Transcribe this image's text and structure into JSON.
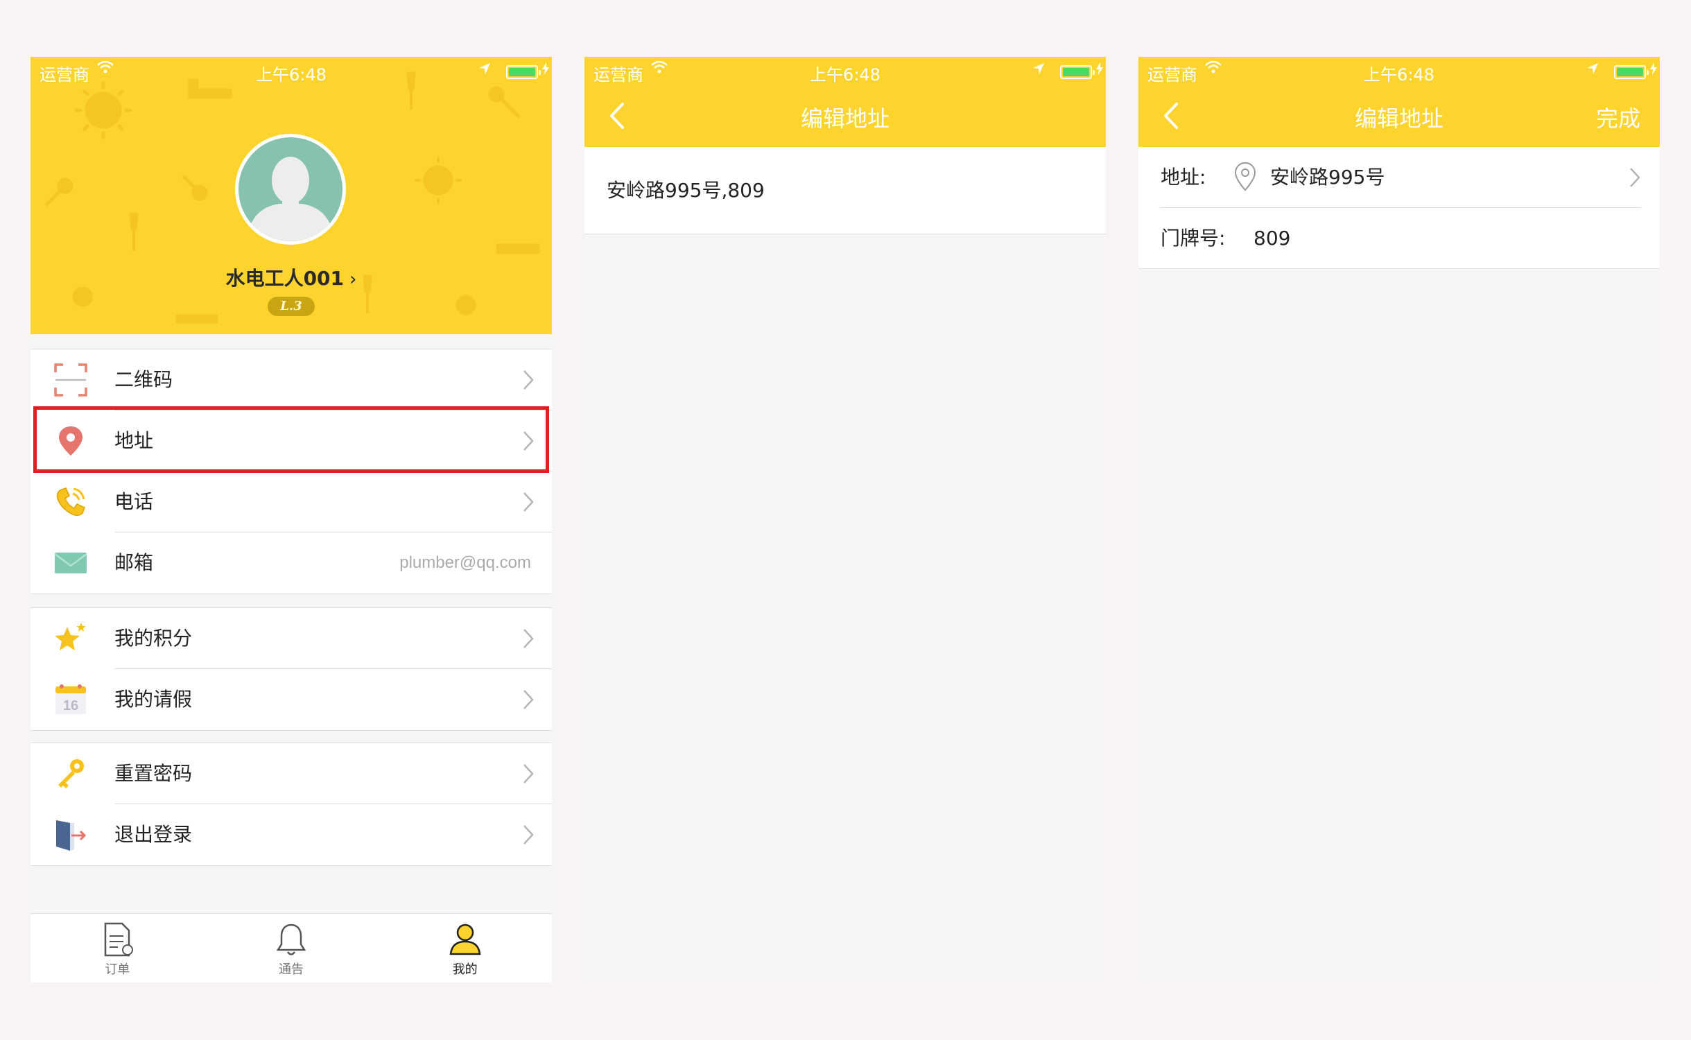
{
  "status_bar": {
    "carrier": "运营商",
    "time": "上午6:48"
  },
  "screen1": {
    "profile": {
      "username": "水电工人001",
      "level": "L.3"
    },
    "menu_group1": [
      {
        "label": "二维码",
        "icon": "qr-scan-icon",
        "value": ""
      },
      {
        "label": "地址",
        "icon": "location-pin-icon",
        "value": ""
      },
      {
        "label": "电话",
        "icon": "phone-icon",
        "value": ""
      },
      {
        "label": "邮箱",
        "icon": "envelope-icon",
        "value": "plumber@qq.com"
      }
    ],
    "menu_group2": [
      {
        "label": "我的积分",
        "icon": "star-icon"
      },
      {
        "label": "我的请假",
        "icon": "calendar-icon",
        "calendar_day": "16"
      }
    ],
    "menu_group3": [
      {
        "label": "重置密码",
        "icon": "key-icon"
      },
      {
        "label": "退出登录",
        "icon": "logout-door-icon"
      }
    ],
    "highlighted_item": "地址",
    "tabs": [
      {
        "label": "订单",
        "icon": "order-document-icon",
        "active": false
      },
      {
        "label": "通告",
        "icon": "bell-icon",
        "active": false
      },
      {
        "label": "我的",
        "icon": "user-icon",
        "active": true
      }
    ]
  },
  "screen2": {
    "nav_title": "编辑地址",
    "address_text": "安岭路995号,809"
  },
  "screen3": {
    "nav_title": "编辑地址",
    "done_label": "完成",
    "address_label": "地址:",
    "address_value": "安岭路995号",
    "door_label": "门牌号:",
    "door_value": "809"
  },
  "colors": {
    "brand_yellow": "#fdd32e",
    "highlight_red": "#e02020",
    "battery_green": "#4cd964",
    "avatar_teal": "#87c2b1",
    "level_badge": "#c9a513"
  }
}
